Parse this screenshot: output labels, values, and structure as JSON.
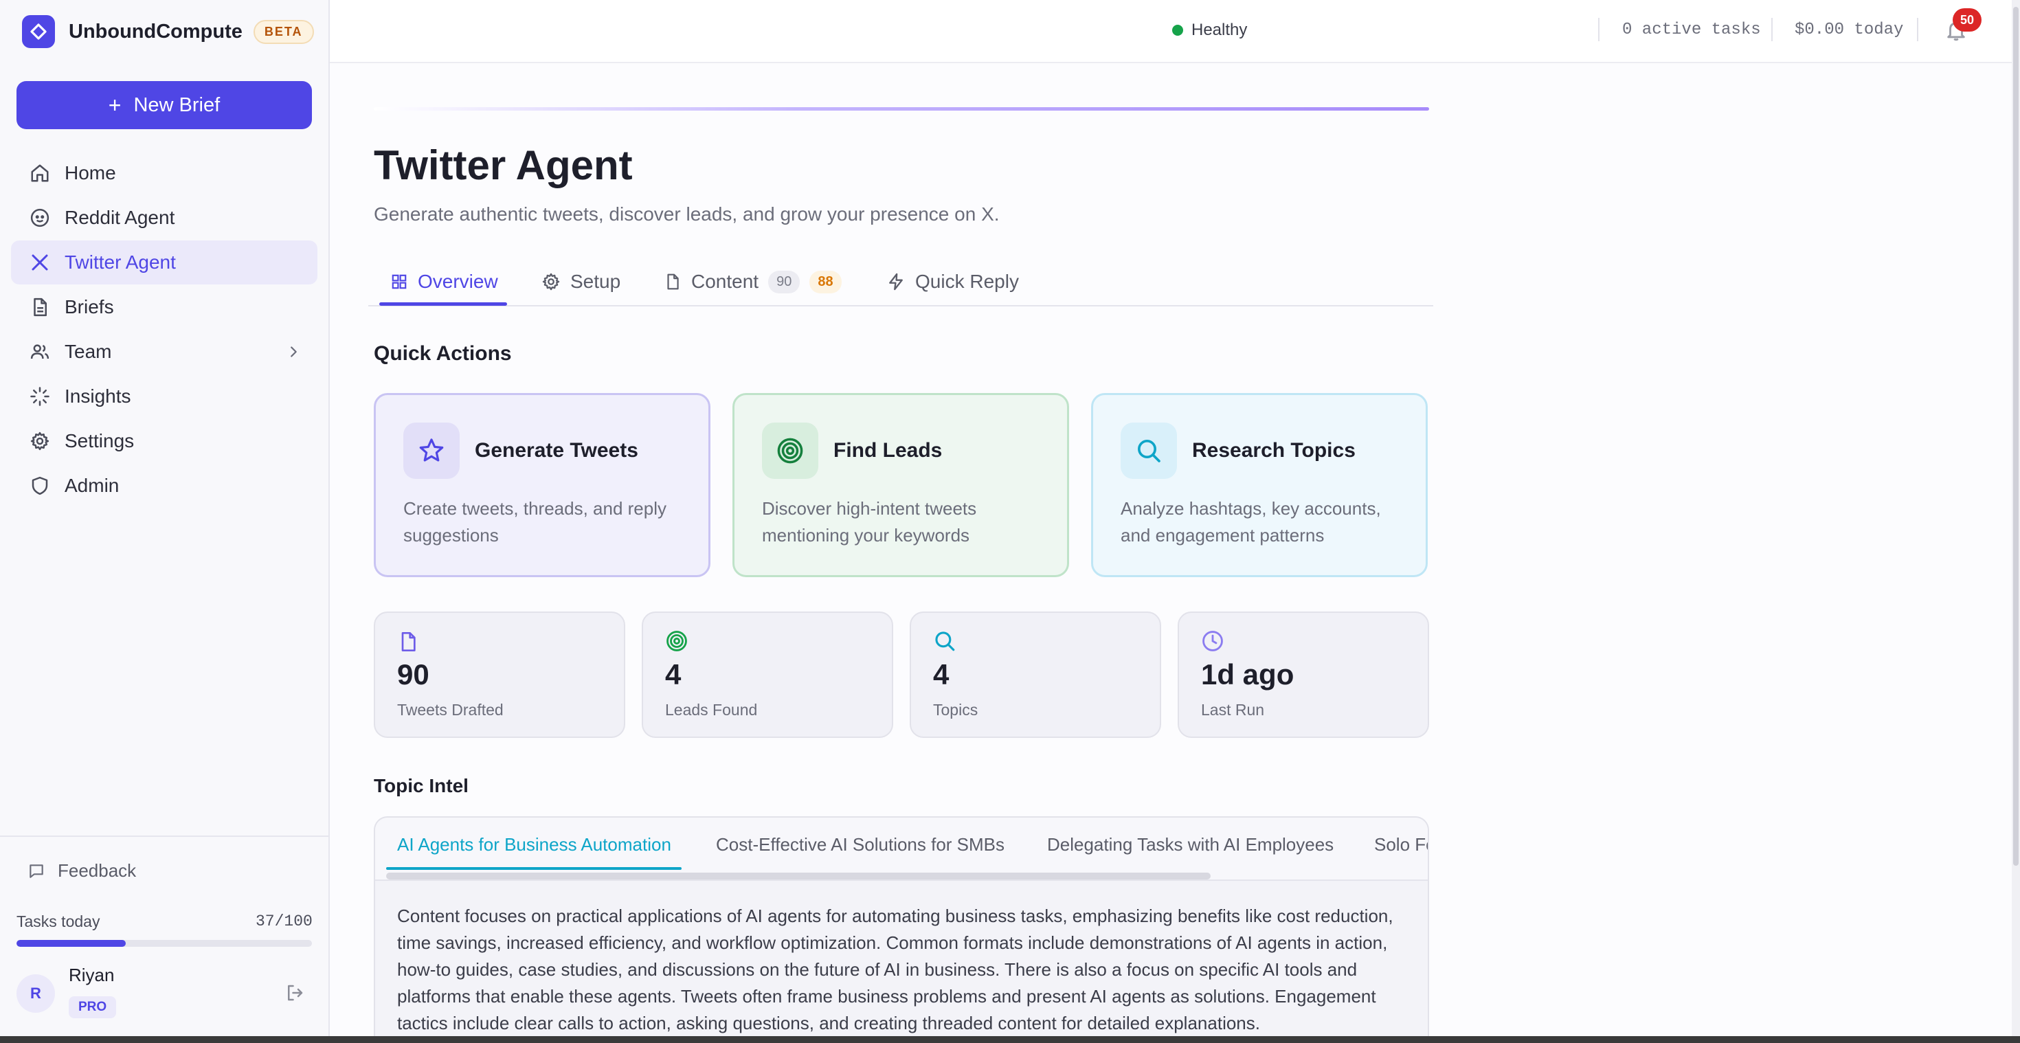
{
  "brand": {
    "name": "UnboundCompute",
    "badge": "BETA"
  },
  "sidebar": {
    "new_brief": "New Brief",
    "items": [
      {
        "label": "Home",
        "icon": "home-icon"
      },
      {
        "label": "Reddit Agent",
        "icon": "reddit-icon"
      },
      {
        "label": "Twitter Agent",
        "icon": "x-icon",
        "active": true
      },
      {
        "label": "Briefs",
        "icon": "document-icon"
      },
      {
        "label": "Team",
        "icon": "users-icon",
        "has_submenu": true
      },
      {
        "label": "Insights",
        "icon": "sparkle-icon"
      },
      {
        "label": "Settings",
        "icon": "gear-icon"
      },
      {
        "label": "Admin",
        "icon": "shield-icon"
      }
    ],
    "feedback": "Feedback",
    "tasks_label": "Tasks today",
    "tasks_count": "37/100",
    "tasks_progress": 0.37,
    "user": {
      "initial": "R",
      "name": "Riyan",
      "plan": "PRO"
    }
  },
  "topbar": {
    "status": "Healthy",
    "active_tasks": "0 active tasks",
    "cost": "$0.00 today",
    "notifications": "50"
  },
  "page": {
    "title": "Twitter Agent",
    "subtitle": "Generate authentic tweets, discover leads, and grow your presence on X."
  },
  "tabs": [
    {
      "label": "Overview",
      "icon": "grid-icon",
      "active": true
    },
    {
      "label": "Setup",
      "icon": "gear-icon"
    },
    {
      "label": "Content",
      "icon": "document-icon",
      "count_a": "90",
      "count_b": "88"
    },
    {
      "label": "Quick Reply",
      "icon": "lightning-icon"
    }
  ],
  "quick_actions": {
    "title": "Quick Actions",
    "cards": [
      {
        "title": "Generate Tweets",
        "desc": "Create tweets, threads, and reply suggestions",
        "icon": "star-icon"
      },
      {
        "title": "Find Leads",
        "desc": "Discover high-intent tweets mentioning your keywords",
        "icon": "target-icon"
      },
      {
        "title": "Research Topics",
        "desc": "Analyze hashtags, key accounts, and engagement patterns",
        "icon": "search-icon"
      }
    ]
  },
  "stats": [
    {
      "value": "90",
      "label": "Tweets Drafted",
      "icon": "document-icon"
    },
    {
      "value": "4",
      "label": "Leads Found",
      "icon": "target-icon"
    },
    {
      "value": "4",
      "label": "Topics",
      "icon": "search-icon"
    },
    {
      "value": "1d ago",
      "label": "Last Run",
      "icon": "clock-icon"
    }
  ],
  "topic_intel": {
    "title": "Topic Intel",
    "tabs": [
      "AI Agents for Business Automation",
      "Cost-Effective AI Solutions for SMBs",
      "Delegating Tasks with AI Employees",
      "Solo Fo"
    ],
    "active_index": 0,
    "content": "Content focuses on practical applications of AI agents for automating business tasks, emphasizing benefits like cost reduction, time savings, increased efficiency, and workflow optimization. Common formats include demonstrations of AI agents in action, how-to guides, case studies, and discussions on the future of AI in business. There is also a focus on specific AI tools and platforms that enable these agents. Tweets often frame business problems and present AI agents as solutions. Engagement tactics include clear calls to action, asking questions, and creating threaded content for detailed explanations."
  },
  "colors": {
    "accent": "#4f46e5",
    "healthy": "#16a34a",
    "notification": "#dc2626",
    "intel_accent": "#0ea5c8"
  }
}
